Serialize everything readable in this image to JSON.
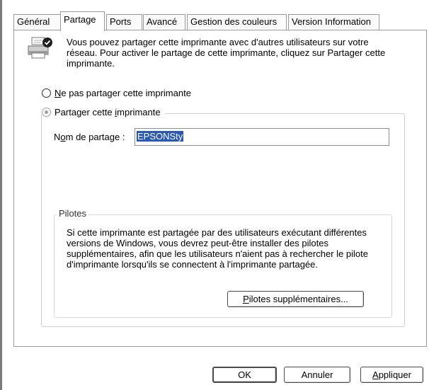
{
  "tabs": [
    {
      "label": "Général",
      "active": false
    },
    {
      "label": "Partage",
      "active": true
    },
    {
      "label": "Ports",
      "active": false
    },
    {
      "label": "Avancé",
      "active": false
    },
    {
      "label": "Gestion des couleurs",
      "active": false
    },
    {
      "label": "Version Information",
      "active": false
    }
  ],
  "intro": {
    "icon": "printer-share-icon",
    "text": "Vous pouvez partager cette imprimante avec d'autres utilisateurs sur votre réseau. Pour activer le partage de cette imprimante, cliquez sur Partager cette imprimante."
  },
  "sharing": {
    "no_share_pre": "",
    "no_share_access": "N",
    "no_share_post": "e pas partager cette imprimante",
    "no_share_checked": false,
    "share_pre": "Partager cette ",
    "share_access": "i",
    "share_post": "mprimante",
    "share_checked": true,
    "share_name_label_pre": "N",
    "share_name_label_access": "o",
    "share_name_label_post": "m de partage :",
    "share_name_value": "EPSONSty"
  },
  "drivers": {
    "legend": "Pilotes",
    "text": "Si cette imprimante est partagée par des utilisateurs exécutant différentes versions de Windows, vous devrez peut-être installer des pilotes supplémentaires, afin que les utilisateurs n'aient pas à rechercher le pilote d'imprimante lorsqu'ils se connectent à l'imprimante partagée.",
    "button_access": "P",
    "button_post": "ilotes supplémentaires..."
  },
  "buttons": {
    "ok": "OK",
    "cancel": "Annuler",
    "apply_access": "A",
    "apply_post": "ppliquer"
  },
  "colors": {
    "selection": "#2a59b5",
    "border": "#9a9a9a"
  }
}
